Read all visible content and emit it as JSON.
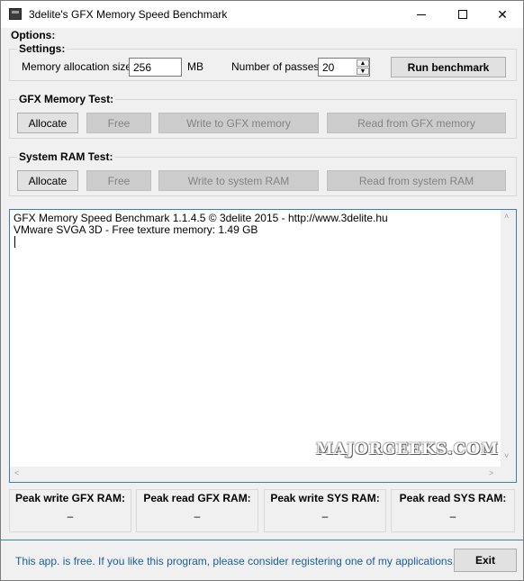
{
  "window": {
    "title": "3delite's GFX Memory Speed Benchmark",
    "minimize_label": "",
    "close_label": "✕"
  },
  "options": {
    "heading": "Options:",
    "settings_heading": "Settings:",
    "memory_label": "Memory allocation size:",
    "memory_value": "256",
    "memory_unit": "MB",
    "passes_label": "Number of passes:",
    "passes_value": "20",
    "run_label": "Run benchmark"
  },
  "gfx_test": {
    "heading": "GFX Memory Test:",
    "allocate": "Allocate",
    "free": "Free",
    "write": "Write to GFX memory",
    "read": "Read from GFX memory"
  },
  "ram_test": {
    "heading": "System RAM Test:",
    "allocate": "Allocate",
    "free": "Free",
    "write": "Write to system RAM",
    "read": "Read from system RAM"
  },
  "log": {
    "lines": [
      "GFX Memory Speed Benchmark 1.1.4.5 © 3delite 2015 - http://www.3delite.hu",
      "VMware SVGA 3D - Free texture memory: 1.49 GB"
    ],
    "watermark": "MAJORGEEKS.COM"
  },
  "peaks": [
    {
      "title": "Peak write GFX RAM:",
      "value": "–"
    },
    {
      "title": "Peak read GFX RAM:",
      "value": "–"
    },
    {
      "title": "Peak write SYS RAM:",
      "value": "–"
    },
    {
      "title": "Peak read SYS RAM:",
      "value": "–"
    }
  ],
  "footer": {
    "message": "This app. is free. If you like this program, please consider registering one of my applications...",
    "exit_label": "Exit"
  },
  "colors": {
    "accent": "#3c7fb1",
    "link_text": "#1a5fa0",
    "disabled_button": "#cccccc"
  }
}
